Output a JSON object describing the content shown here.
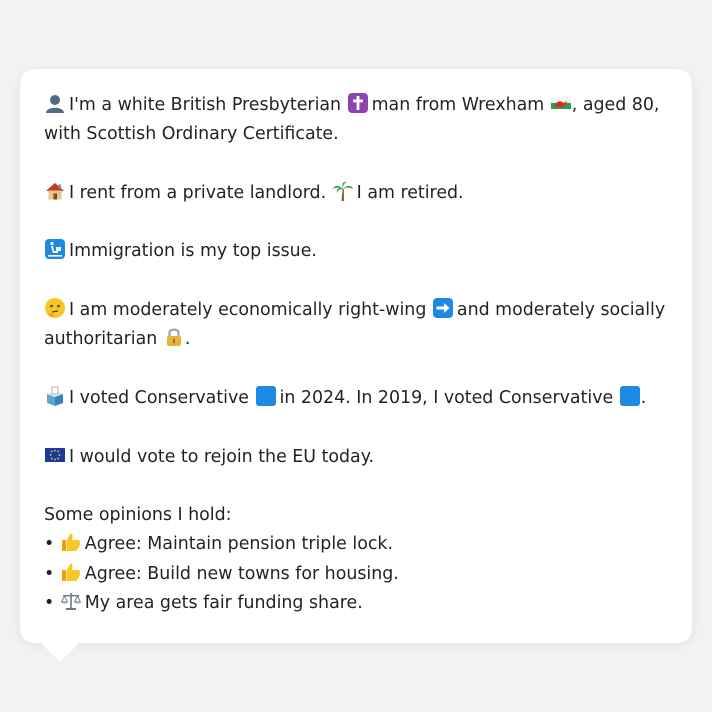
{
  "profile": {
    "identity_pre": "I'm a white British Presbyterian",
    "identity_mid": "man from Wrexham",
    "identity_post": ", aged 80, with Scottish Ordinary Certificate.",
    "housing": "I rent from a private landlord.",
    "work": "I am retired.",
    "issue": "Immigration is my top issue.",
    "ideology_pre": "I am moderately economically right-wing",
    "ideology_mid": "and moderately socially authoritarian",
    "ideology_post": ".",
    "vote_2024_pre": "I voted Conservative",
    "vote_2024_post": "in 2024. In 2019, I voted Conservative",
    "vote_2019_post": ".",
    "eu": "I would vote to rejoin the EU today."
  },
  "opinions": {
    "heading": "Some opinions I hold:",
    "bullet": "•",
    "items": [
      {
        "icon": "thumbs-up-icon",
        "text": "Agree: Maintain pension triple lock."
      },
      {
        "icon": "thumbs-up-icon",
        "text": "Agree: Build new towns for housing."
      },
      {
        "icon": "balance-scale-icon",
        "text": "My area gets fair funding share."
      }
    ]
  },
  "icons": {
    "person": "bust-silhouette-icon",
    "religion": "latin-cross-icon",
    "region": "wales-flag-icon",
    "housing": "house-icon",
    "work": "palm-tree-icon",
    "issue": "baggage-claim-icon",
    "thinking": "thinking-face-icon",
    "economic": "right-arrow-icon",
    "social": "lock-icon",
    "ballot": "ballot-box-icon",
    "party_2024": "blue-square-icon",
    "party_2019": "blue-square-icon",
    "eu": "eu-flag-icon"
  },
  "colors": {
    "background": "#f1f2f4",
    "card": "#ffffff",
    "text": "#1f2328",
    "conservative_blue": "#1e88e5",
    "eu_blue": "#1a3a9c",
    "religion_purple": "#8e44ad"
  }
}
